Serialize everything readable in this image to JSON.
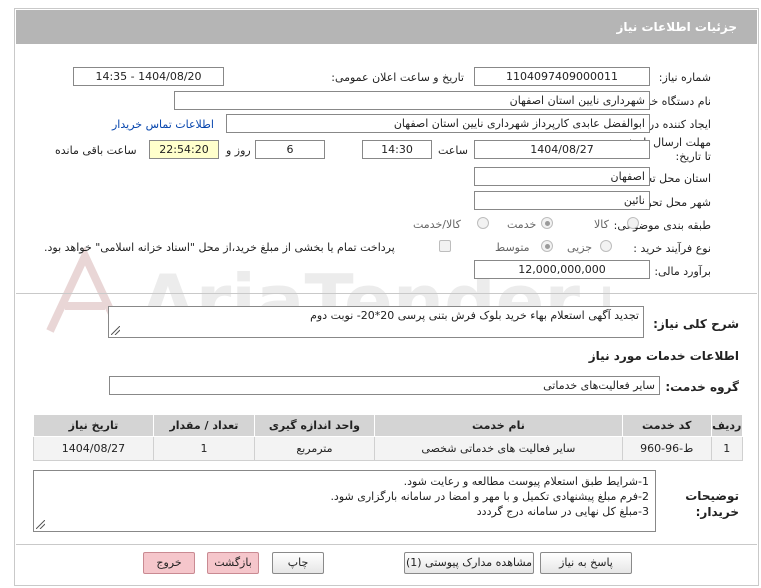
{
  "title": "جزئیات اطلاعات نیاز",
  "fields": {
    "need_number_label": "شماره نیاز:",
    "need_number": "1104097409000011",
    "announce_label": "تاریخ و ساعت اعلان عمومی:",
    "announce_value": "1404/08/20 - 14:35",
    "buyer_org_label": "نام دستگاه خریدار:",
    "buyer_org": "شهرداری نایین استان اصفهان",
    "creator_label": "ایجاد کننده درخواست:",
    "creator": "ابوالفضل عابدی کارپرداز شهرداری نایین استان اصفهان",
    "contact_link": "اطلاعات تماس خریدار",
    "deadline_label": "مهلت ارسال پاسخ: تا تاریخ:",
    "deadline_date": "1404/08/27",
    "time_label": "ساعت",
    "deadline_time": "14:30",
    "days_value": "6",
    "days_label": "روز و",
    "remaining_time": "22:54:20",
    "remaining_label": "ساعت باقی مانده",
    "province_label": "استان محل تحویل:",
    "province": "اصفهان",
    "city_label": "شهر محل تحویل:",
    "city": "نائین",
    "category_label": "طبقه بندی موضوعی:",
    "category_options": [
      "کالا",
      "خدمت",
      "کالا/خدمت"
    ],
    "category_selected": "خدمت",
    "process_label": "نوع فرآیند خرید :",
    "process_options": [
      "جزیی",
      "متوسط"
    ],
    "process_selected": "متوسط",
    "payment_note": "پرداخت تمام یا بخشی از مبلغ خرید،از محل \"اسناد خزانه اسلامی\" خواهد بود.",
    "budget_label": "برآورد مالی:",
    "budget": "12,000,000,000"
  },
  "description": {
    "label": "شرح کلی نیاز:",
    "text": "تجدید آگهی استعلام بهاء خرید بلوک فرش بتنی پرسی 20*20- نوبت دوم"
  },
  "services": {
    "section_title": "اطلاعات خدمات مورد نیاز",
    "group_label": "گروه خدمت:",
    "group_value": "سایر فعالیت‌های خدماتی",
    "table": {
      "headers": [
        "ردیف",
        "کد خدمت",
        "نام خدمت",
        "واحد اندازه گیری",
        "تعداد / مقدار",
        "تاریخ نیاز"
      ],
      "rows": [
        [
          "1",
          "ط-96-960",
          "سایر فعالیت های خدماتی شخصی",
          "مترمربع",
          "1",
          "1404/08/27"
        ]
      ]
    }
  },
  "buyer_notes": {
    "label": "توضیحات خریدار:",
    "lines": [
      "1-شرایط طبق استعلام پیوست مطالعه و رعایت شود.",
      "2-فرم مبلغ پیشنهادی تکمیل و با مهر و امضا در سامانه بارگزاری شود.",
      "3-مبلغ کل نهایی در سامانه درج گرددد"
    ]
  },
  "buttons": {
    "respond": "پاسخ به نیاز",
    "attachments": "مشاهده مدارک پیوستی (1)",
    "print": "چاپ",
    "back": "بازگشت",
    "exit": "خروج"
  },
  "watermark": "AriaTender.net",
  "colors": {
    "titlebar": "#b5b5b5",
    "highlight": "#ffffcc",
    "link": "#0645ad",
    "danger_button": "#f5c6cb"
  }
}
